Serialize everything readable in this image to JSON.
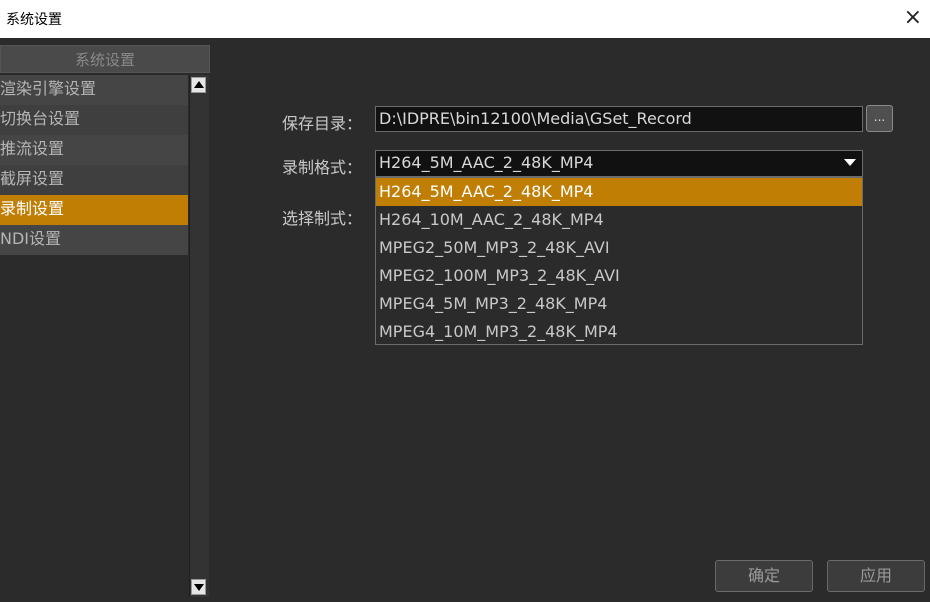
{
  "window": {
    "title": "系统设置",
    "close_glyph": "×"
  },
  "sidebar": {
    "header": "系统设置",
    "items": [
      {
        "label": "渲染引擎设置",
        "active": false
      },
      {
        "label": "切换台设置",
        "active": false
      },
      {
        "label": "推流设置",
        "active": false
      },
      {
        "label": "截屏设置",
        "active": false
      },
      {
        "label": "录制设置",
        "active": true
      },
      {
        "label": "NDI设置",
        "active": false
      }
    ]
  },
  "form": {
    "save_dir_label": "保存目录：",
    "save_dir_value": "D:\\IDPRE\\bin12100\\Media\\GSet_Record",
    "browse_label": "...",
    "format_label": "录制格式：",
    "format_value": "H264_5M_AAC_2_48K_MP4",
    "standard_label": "选择制式：",
    "format_options": [
      "H264_5M_AAC_2_48K_MP4",
      "H264_10M_AAC_2_48K_MP4",
      "MPEG2_50M_MP3_2_48K_AVI",
      "MPEG2_100M_MP3_2_48K_AVI",
      "MPEG4_5M_MP3_2_48K_MP4",
      "MPEG4_10M_MP3_2_48K_MP4"
    ]
  },
  "buttons": {
    "confirm": "确定",
    "apply": "应用"
  },
  "colors": {
    "accent": "#c07e05",
    "background": "#2b2b2b"
  }
}
